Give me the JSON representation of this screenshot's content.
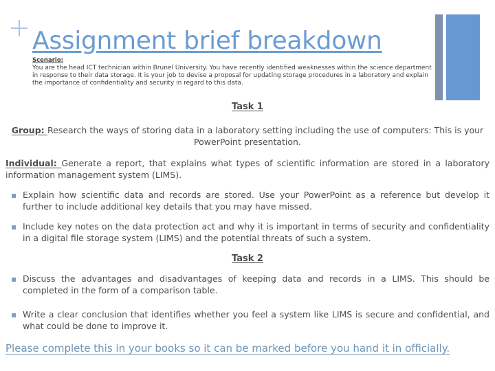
{
  "slide": {
    "title": "Assignment brief breakdown",
    "scenario": {
      "label": "Scenario:",
      "body": "You are the head ICT technician within Brunel University. You have recently identified weaknesses within the science department in response to their data storage. It is your job to devise a proposal for updating storage procedures in a laboratory and explain the importance of confidentiality and security in regard to this data."
    },
    "task1": {
      "heading": "Task 1",
      "group_label": "Group: ",
      "group_text": "Research the ways of storing data in a laboratory setting including the use of computers: This is your PowerPoint presentation.",
      "individual_label": "Individual: ",
      "individual_text": "Generate a report, that explains what types of scientific information are stored in a laboratory information management system (LIMS).",
      "bullets": [
        "Explain how scientific data and records are stored. Use your PowerPoint as a reference but develop it further to include additional key details that you may have missed.",
        "Include key notes on the data protection act and why it is important in terms of security and confidentiality in a digital file storage system (LIMS) and the potential threats of such a system."
      ]
    },
    "task2": {
      "heading": "Task 2",
      "bullets": [
        "Discuss the advantages and disadvantages of keeping data and records in a LIMS. This should be completed in the form of a comparison table.",
        "Write a clear conclusion that identifies whether you feel a system like LIMS is secure and confidential, and what could be done to improve it."
      ]
    },
    "closing": "Please complete this in your books so it can be marked before you hand it in officially.",
    "colors": {
      "title_blue": "#6c9cd2",
      "deco_blue": "#6699d3",
      "deco_gray": "#7e92ac",
      "bullet_square": "#7e9cc4",
      "closing_blue": "#6d94b5",
      "body_gray": "#4d4d4d",
      "plus_blue": "#a8c6e6"
    },
    "icons": {
      "plus": "plus-icon"
    }
  }
}
